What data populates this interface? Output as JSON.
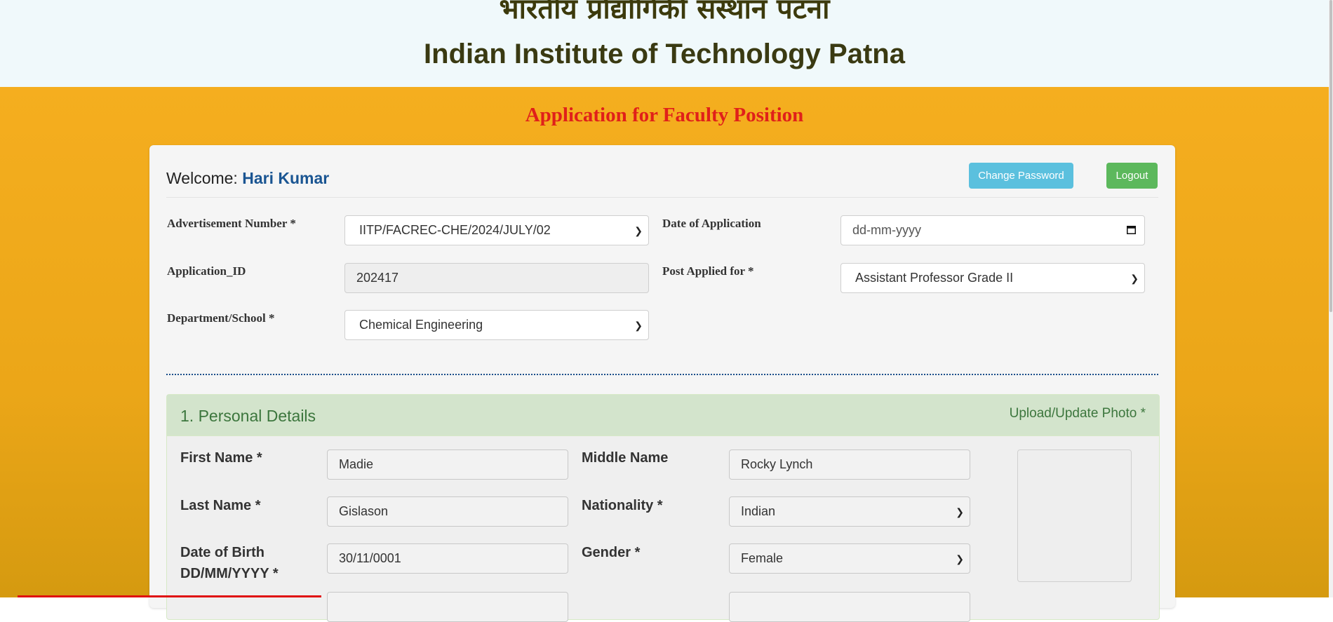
{
  "header": {
    "hindi_title": "भारतीय प्रौद्योगिकी संस्थान पटना",
    "english_title": "Indian Institute of Technology Patna"
  },
  "page_heading": "Application for Faculty Position",
  "welcome": {
    "prefix": "Welcome: ",
    "user_name": "Hari Kumar"
  },
  "buttons": {
    "change_password": "Change Password",
    "logout": "Logout"
  },
  "application": {
    "advertisement_label": "Advertisement Number *",
    "advertisement_value": "IITP/FACREC-CHE/2024/JULY/02",
    "date_label": "Date of Application",
    "date_placeholder": "dd-mm-yyyy",
    "app_id_label": "Application_ID",
    "app_id_value": "202417",
    "post_label": "Post Applied for *",
    "post_value": "Assistant Professor Grade II",
    "department_label": "Department/School *",
    "department_value": "Chemical Engineering"
  },
  "personal": {
    "title": "1. Personal Details",
    "upload_photo": "Upload/Update Photo *",
    "first_name_label": "First Name *",
    "first_name_value": "Madie",
    "middle_name_label": "Middle Name",
    "middle_name_value": "Rocky Lynch",
    "last_name_label": "Last Name *",
    "last_name_value": "Gislason",
    "nationality_label": "Nationality *",
    "nationality_value": "Indian",
    "dob_label_line1": "Date of Birth",
    "dob_label_line2": "DD/MM/YYYY *",
    "dob_value": "30/11/0001",
    "gender_label": "Gender *",
    "gender_value": "Female"
  },
  "icons": {
    "select_arrow": "chevron-down-icon",
    "date_picker": "calendar-icon"
  },
  "colors": {
    "page_bg": "#f5ae1f",
    "heading_red": "#e0201a",
    "user_name_blue": "#1a5592",
    "change_password_btn": "#5bc0de",
    "logout_btn": "#5cb85c",
    "panel_green": "#3c763d"
  }
}
